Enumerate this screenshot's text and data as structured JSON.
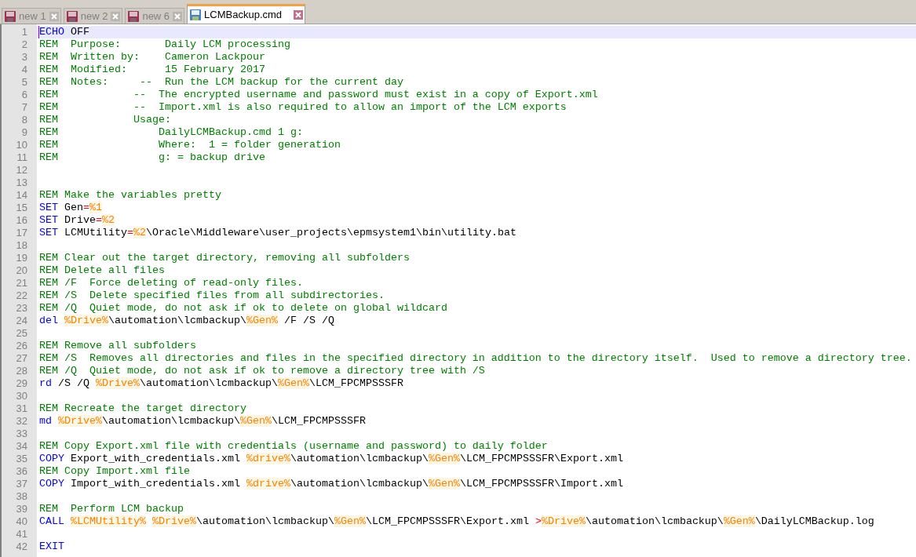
{
  "tabs": [
    {
      "label": "new 1",
      "selected": false,
      "saved": false
    },
    {
      "label": "new 2",
      "selected": false,
      "saved": false
    },
    {
      "label": "new 6",
      "selected": false,
      "saved": false
    },
    {
      "label": "LCMBackup.cmd",
      "selected": true,
      "saved": true
    }
  ],
  "editor": {
    "lines": [
      {
        "number": "1",
        "selected": true,
        "tokens": [
          {
            "kind": "keyword",
            "text": "ECHO"
          },
          {
            "kind": "text",
            "text": " OFF"
          }
        ]
      },
      {
        "number": "2",
        "selected": false,
        "tokens": [
          {
            "kind": "comment",
            "text": "REM  Purpose:       Daily LCM processing"
          }
        ]
      },
      {
        "number": "3",
        "selected": false,
        "tokens": [
          {
            "kind": "comment",
            "text": "REM  Written by:    Cameron Lackpour"
          }
        ]
      },
      {
        "number": "4",
        "selected": false,
        "tokens": [
          {
            "kind": "comment",
            "text": "REM  Modified:      15 February 2017"
          }
        ]
      },
      {
        "number": "5",
        "selected": false,
        "tokens": [
          {
            "kind": "comment",
            "text": "REM  Notes:     --  Run the LCM backup for the current day"
          }
        ]
      },
      {
        "number": "6",
        "selected": false,
        "tokens": [
          {
            "kind": "comment",
            "text": "REM            --  The encrypted username and password must exist in a copy of Export.xml"
          }
        ]
      },
      {
        "number": "7",
        "selected": false,
        "tokens": [
          {
            "kind": "comment",
            "text": "REM            --  Import.xml is also required to allow an import of the LCM exports"
          }
        ]
      },
      {
        "number": "8",
        "selected": false,
        "tokens": [
          {
            "kind": "comment",
            "text": "REM            Usage:"
          }
        ]
      },
      {
        "number": "9",
        "selected": false,
        "tokens": [
          {
            "kind": "comment",
            "text": "REM                DailyLCMBackup.cmd 1 g:"
          }
        ]
      },
      {
        "number": "10",
        "selected": false,
        "tokens": [
          {
            "kind": "comment",
            "text": "REM                Where:  1 = folder generation"
          }
        ]
      },
      {
        "number": "11",
        "selected": false,
        "tokens": [
          {
            "kind": "comment",
            "text": "REM                g: = backup drive"
          }
        ]
      },
      {
        "number": "12",
        "selected": false
      },
      {
        "number": "13",
        "selected": false
      },
      {
        "number": "14",
        "selected": false,
        "tokens": [
          {
            "kind": "comment",
            "text": "REM Make the variables pretty"
          }
        ]
      },
      {
        "number": "15",
        "selected": false,
        "tokens": [
          {
            "kind": "keyword",
            "text": "SET"
          },
          {
            "kind": "text",
            "text": " Gen"
          },
          {
            "kind": "operator",
            "text": "="
          },
          {
            "kind": "variable",
            "text": "%1"
          }
        ]
      },
      {
        "number": "16",
        "selected": false,
        "tokens": [
          {
            "kind": "keyword",
            "text": "SET"
          },
          {
            "kind": "text",
            "text": " Drive"
          },
          {
            "kind": "operator",
            "text": "="
          },
          {
            "kind": "variable",
            "text": "%2"
          }
        ]
      },
      {
        "number": "17",
        "selected": false,
        "tokens": [
          {
            "kind": "keyword",
            "text": "SET"
          },
          {
            "kind": "text",
            "text": " LCMUtility"
          },
          {
            "kind": "operator",
            "text": "="
          },
          {
            "kind": "variable",
            "text": "%2"
          },
          {
            "kind": "text",
            "text": "\\Oracle\\Middleware\\user_projects\\epmsystem1\\bin\\utility.bat"
          }
        ]
      },
      {
        "number": "18",
        "selected": false
      },
      {
        "number": "19",
        "selected": false,
        "tokens": [
          {
            "kind": "comment",
            "text": "REM Clear out the target directory, removing all subfolders"
          }
        ]
      },
      {
        "number": "20",
        "selected": false,
        "tokens": [
          {
            "kind": "comment",
            "text": "REM Delete all files"
          }
        ]
      },
      {
        "number": "21",
        "selected": false,
        "tokens": [
          {
            "kind": "comment",
            "text": "REM /F  Force deleting of read-only files."
          }
        ]
      },
      {
        "number": "22",
        "selected": false,
        "tokens": [
          {
            "kind": "comment",
            "text": "REM /S  Delete specified files from all subdirectories."
          }
        ]
      },
      {
        "number": "23",
        "selected": false,
        "tokens": [
          {
            "kind": "comment",
            "text": "REM /Q  Quiet mode, do not ask if ok to delete on global wildcard"
          }
        ]
      },
      {
        "number": "24",
        "selected": false,
        "tokens": [
          {
            "kind": "keyword",
            "text": "del "
          },
          {
            "kind": "variable",
            "text": "%Drive%"
          },
          {
            "kind": "text",
            "text": "\\automation\\lcmbackup\\"
          },
          {
            "kind": "variable",
            "text": "%Gen%"
          },
          {
            "kind": "text",
            "text": " /F /S /Q"
          }
        ]
      },
      {
        "number": "25",
        "selected": false
      },
      {
        "number": "26",
        "selected": false,
        "tokens": [
          {
            "kind": "comment",
            "text": "REM Remove all subfolders"
          }
        ]
      },
      {
        "number": "27",
        "selected": false,
        "tokens": [
          {
            "kind": "comment",
            "text": "REM /S  Removes all directories and files in the specified directory in addition to the directory itself.  Used to remove a directory tree."
          }
        ]
      },
      {
        "number": "28",
        "selected": false,
        "tokens": [
          {
            "kind": "comment",
            "text": "REM /Q  Quiet mode, do not ask if ok to remove a directory tree with /S"
          }
        ]
      },
      {
        "number": "29",
        "selected": false,
        "tokens": [
          {
            "kind": "keyword",
            "text": "rd"
          },
          {
            "kind": "text",
            "text": " /S /Q "
          },
          {
            "kind": "variable",
            "text": "%Drive%"
          },
          {
            "kind": "text",
            "text": "\\automation\\lcmbackup\\"
          },
          {
            "kind": "variable",
            "text": "%Gen%"
          },
          {
            "kind": "text",
            "text": "\\LCM_FPCMPSSSFR"
          }
        ]
      },
      {
        "number": "30",
        "selected": false
      },
      {
        "number": "31",
        "selected": false,
        "tokens": [
          {
            "kind": "comment",
            "text": "REM Recreate the target directory"
          }
        ]
      },
      {
        "number": "32",
        "selected": false,
        "tokens": [
          {
            "kind": "keyword",
            "text": "md "
          },
          {
            "kind": "variable",
            "text": "%Drive%"
          },
          {
            "kind": "text",
            "text": "\\automation\\lcmbackup\\"
          },
          {
            "kind": "variable",
            "text": "%Gen%"
          },
          {
            "kind": "text",
            "text": "\\LCM_FPCMPSSSFR"
          }
        ]
      },
      {
        "number": "33",
        "selected": false
      },
      {
        "number": "34",
        "selected": false,
        "tokens": [
          {
            "kind": "comment",
            "text": "REM Copy Export.xml file with credentials (username and password) to daily folder"
          }
        ]
      },
      {
        "number": "35",
        "selected": false,
        "tokens": [
          {
            "kind": "keyword",
            "text": "COPY"
          },
          {
            "kind": "text",
            "text": " Export_with_credentials.xml "
          },
          {
            "kind": "variable",
            "text": "%drive%"
          },
          {
            "kind": "text",
            "text": "\\automation\\lcmbackup\\"
          },
          {
            "kind": "variable",
            "text": "%Gen%"
          },
          {
            "kind": "text",
            "text": "\\LCM_FPCMPSSSFR\\Export.xml"
          }
        ]
      },
      {
        "number": "36",
        "selected": false,
        "tokens": [
          {
            "kind": "comment",
            "text": "REM Copy Import.xml file"
          }
        ]
      },
      {
        "number": "37",
        "selected": false,
        "tokens": [
          {
            "kind": "keyword",
            "text": "COPY"
          },
          {
            "kind": "text",
            "text": " Import_with_credentials.xml "
          },
          {
            "kind": "variable",
            "text": "%drive%"
          },
          {
            "kind": "text",
            "text": "\\automation\\lcmbackup\\"
          },
          {
            "kind": "variable",
            "text": "%Gen%"
          },
          {
            "kind": "text",
            "text": "\\LCM_FPCMPSSSFR\\Import.xml"
          }
        ]
      },
      {
        "number": "38",
        "selected": false
      },
      {
        "number": "39",
        "selected": false,
        "tokens": [
          {
            "kind": "comment",
            "text": "REM  Perform LCM backup"
          }
        ]
      },
      {
        "number": "40",
        "selected": false,
        "tokens": [
          {
            "kind": "keyword",
            "text": "CALL "
          },
          {
            "kind": "variable",
            "text": "%LCMUtility% "
          },
          {
            "kind": "variable",
            "text": "%Drive%"
          },
          {
            "kind": "text",
            "text": "\\automation\\lcmbackup\\"
          },
          {
            "kind": "variable",
            "text": "%Gen%"
          },
          {
            "kind": "text",
            "text": "\\LCM_FPCMPSSSFR\\Export.xml "
          },
          {
            "kind": "operator",
            "text": ">"
          },
          {
            "kind": "variable",
            "text": "%Drive%"
          },
          {
            "kind": "text",
            "text": "\\automation\\lcmbackup\\"
          },
          {
            "kind": "variable",
            "text": "%Gen%"
          },
          {
            "kind": "text",
            "text": "\\DailyLCMBackup.log"
          }
        ]
      },
      {
        "number": "41",
        "selected": false
      },
      {
        "number": "42",
        "selected": false,
        "tokens": [
          {
            "kind": "keyword",
            "text": "EXIT"
          }
        ]
      }
    ]
  }
}
